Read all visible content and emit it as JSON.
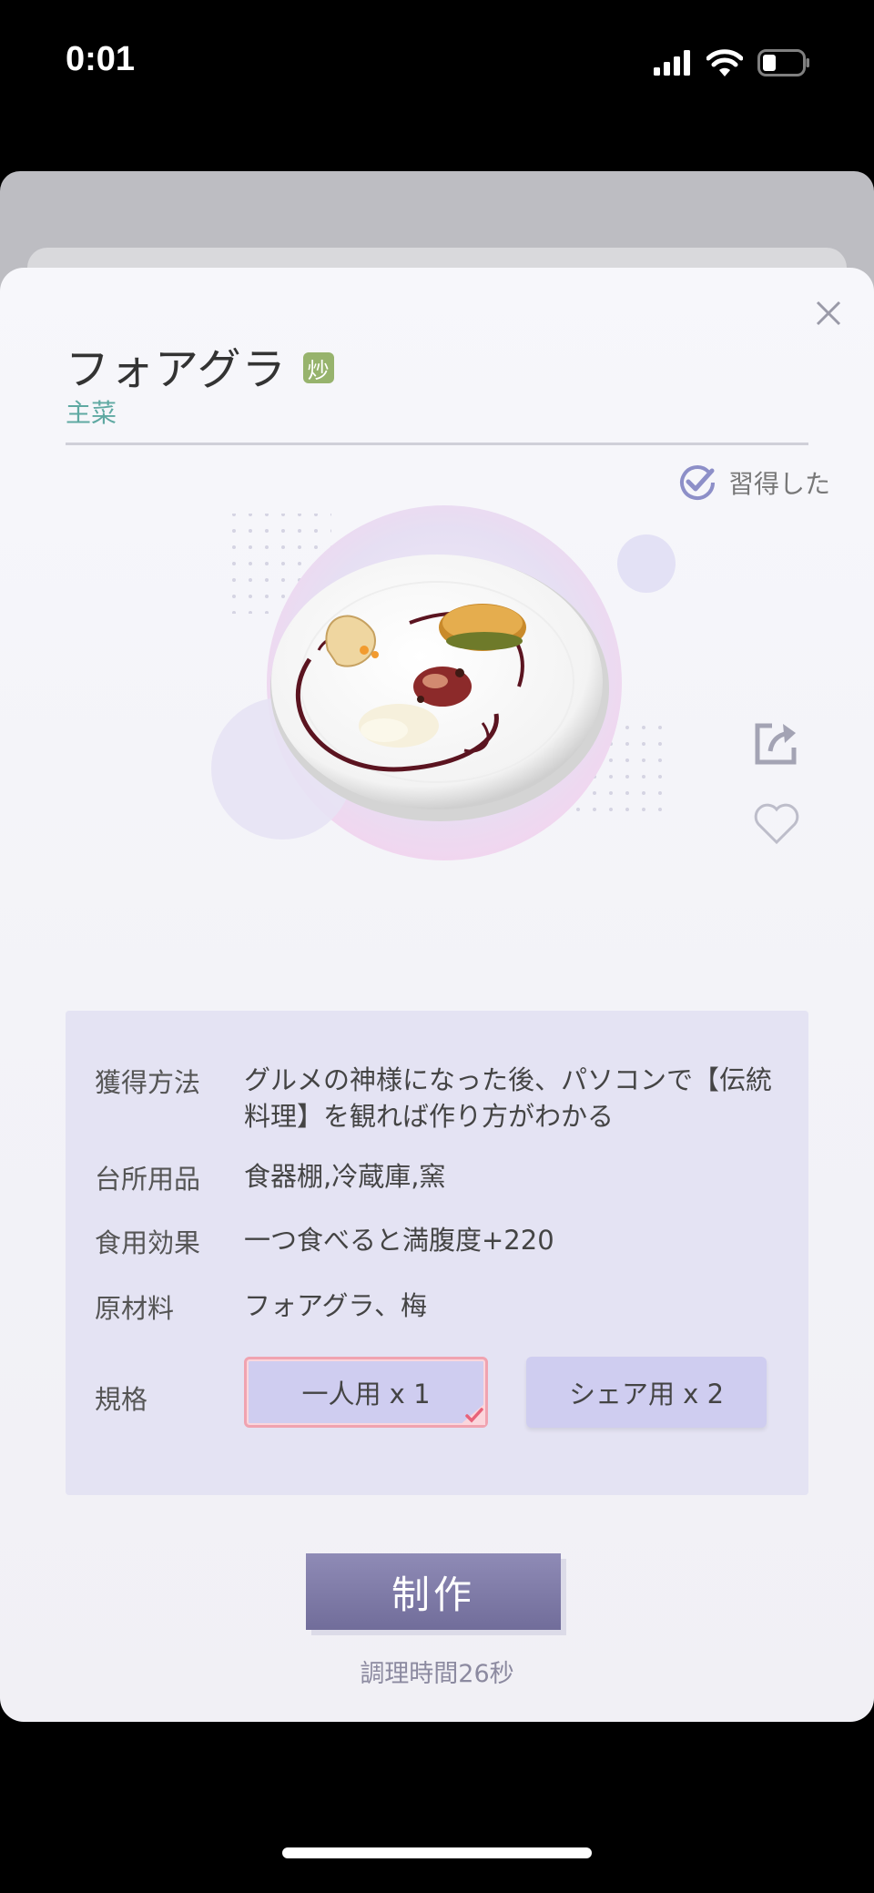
{
  "status_bar": {
    "time": "0:01"
  },
  "dish": {
    "title": "フォアグラ",
    "badge": "炒",
    "category": "主菜",
    "learned_label": "習得した"
  },
  "info": {
    "rows": [
      {
        "label": "獲得方法",
        "value": "グルメの神様になった後、パソコンで【伝統料理】を観れば作り方がわかる"
      },
      {
        "label": "台所用品",
        "value": "食器棚,冷蔵庫,窯"
      },
      {
        "label": "食用効果",
        "value": "一つ食べると満腹度+220"
      },
      {
        "label": "原材料",
        "value": "フォアグラ、梅"
      }
    ],
    "spec_label": "規格",
    "spec_options": [
      {
        "label": "一人用 x 1",
        "selected": true
      },
      {
        "label": "シェア用 x 2",
        "selected": false
      }
    ]
  },
  "actions": {
    "make_label": "制作",
    "cook_time": "調理時間26秒"
  },
  "colors": {
    "accent": "#716d9a",
    "panel": "#e4e3f3",
    "selected_border": "#f0a3b0",
    "category_text": "#5fa9a2",
    "badge": "#97b36d"
  },
  "icons": [
    "signal-icon",
    "wifi-icon",
    "battery-icon",
    "close-icon",
    "check-circle-icon",
    "share-icon",
    "heart-icon",
    "checkmark-icon"
  ]
}
